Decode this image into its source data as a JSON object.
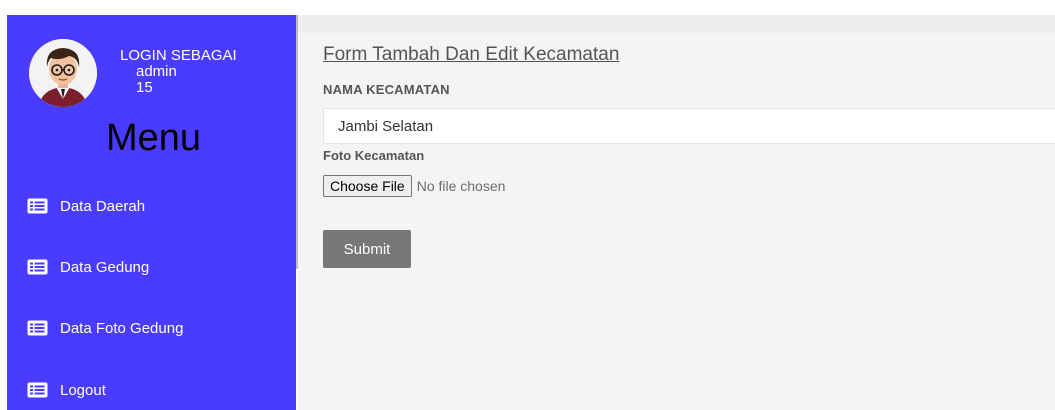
{
  "sidebar": {
    "login_label": "LOGIN SEBAGAI",
    "username": "admin",
    "user_id": "15",
    "menu_title": "Menu",
    "items": [
      {
        "label": "Data Daerah",
        "icon": "list-icon"
      },
      {
        "label": "Data Gedung",
        "icon": "list-icon"
      },
      {
        "label": "Data Foto Gedung",
        "icon": "list-icon"
      },
      {
        "label": "Logout",
        "icon": "list-icon"
      }
    ],
    "color": "#4a3cff"
  },
  "form": {
    "title": "Form Tambah Dan Edit Kecamatan",
    "name_label": "NAMA KECAMATAN",
    "name_value": "Jambi Selatan",
    "photo_label": "Foto Kecamatan",
    "choose_file_label": "Choose File",
    "no_file_text": "No file chosen",
    "submit_label": "Submit"
  }
}
